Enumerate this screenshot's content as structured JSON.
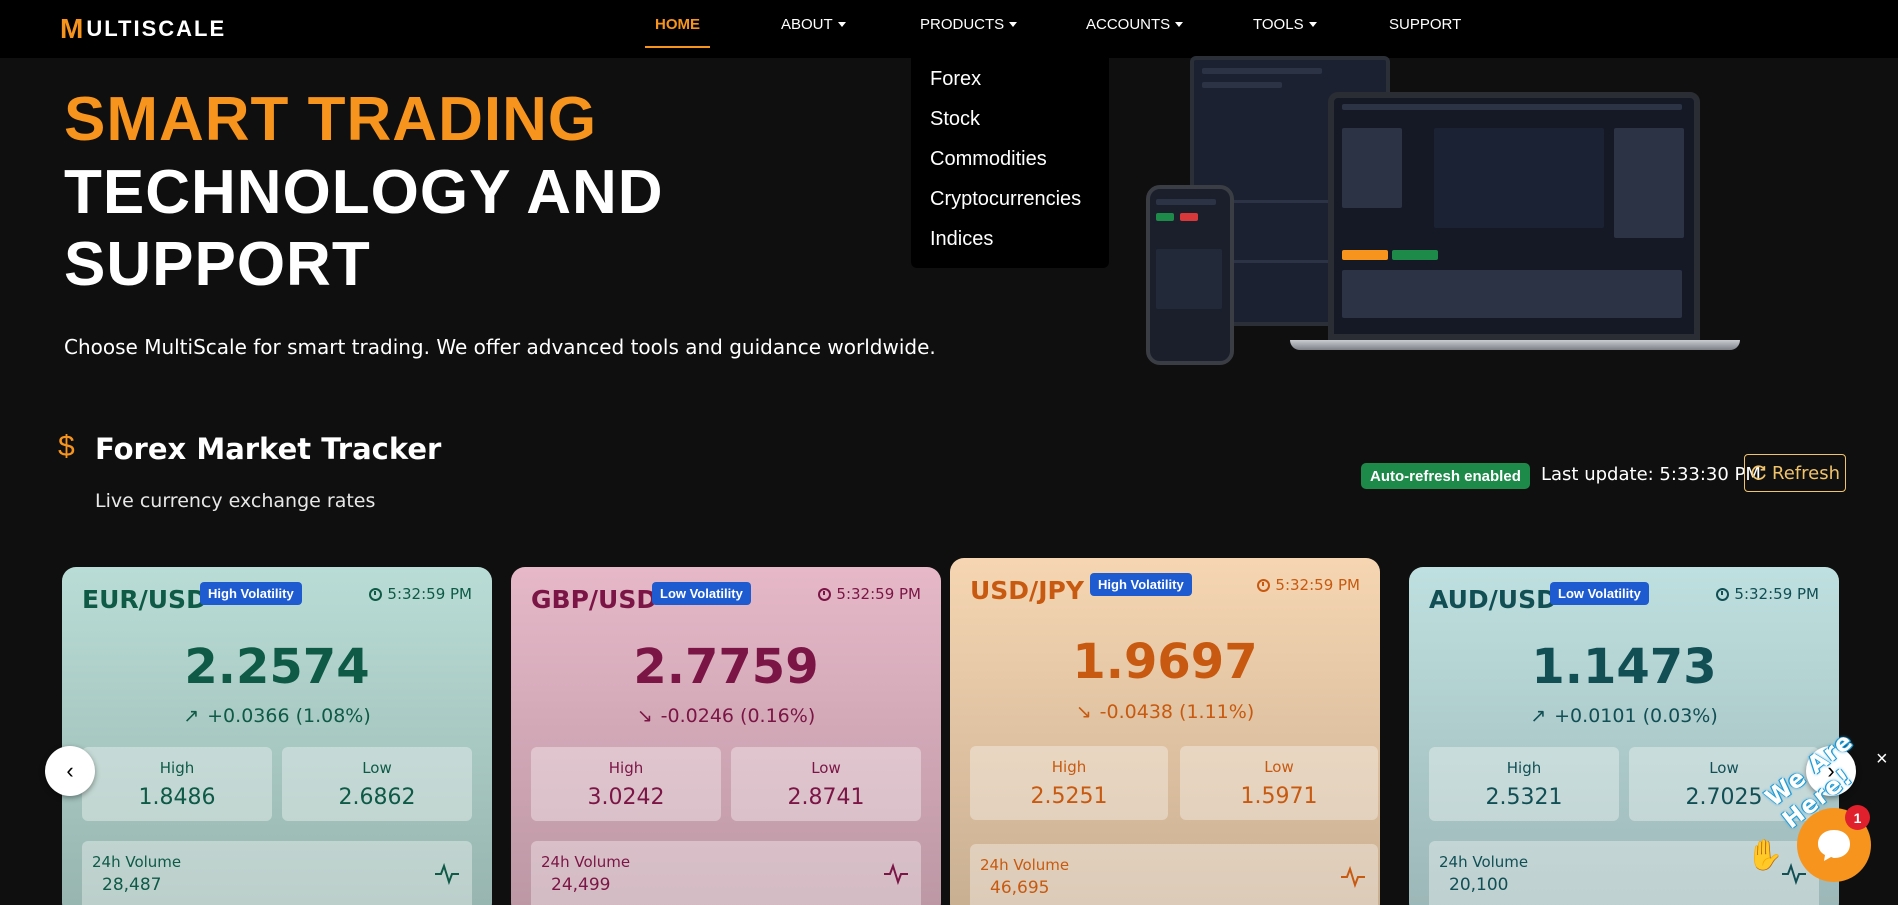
{
  "brand": {
    "logo_mark": "M",
    "logo_text": "ULTISCALE",
    "accent_color": "#f7941d"
  },
  "nav": {
    "home": "HOME",
    "about": "ABOUT",
    "products": "PRODUCTS",
    "accounts": "ACCOUNTS",
    "tools": "TOOLS",
    "support": "SUPPORT"
  },
  "products_menu": [
    "Forex",
    "Stock",
    "Commodities",
    "Cryptocurrencies",
    "Indices"
  ],
  "hero": {
    "line1": "SMART TRADING",
    "line2": "TECHNOLOGY AND",
    "line3": "SUPPORT",
    "subtitle": "Choose MultiScale for smart trading. We offer advanced tools and guidance worldwide."
  },
  "tracker": {
    "icon": "dollar-icon",
    "title": "Forex Market Tracker",
    "subtitle": "Live currency exchange rates",
    "auto_refresh": "Auto-refresh enabled",
    "last_update": "Last update: 5:33:30 PM",
    "refresh_label": "Refresh"
  },
  "cards": [
    {
      "pair": "EUR/USD",
      "volatility": "High Volatility",
      "time": "5:32:59 PM",
      "price": "2.2574",
      "change": "+0.0366 (1.08%)",
      "direction": "up",
      "high_label": "High",
      "high": "1.8486",
      "low_label": "Low",
      "low": "2.6862",
      "volume_label": "24h Volume",
      "volume": "28,487",
      "bg": "#b9ddd6",
      "text_color": "#0e5a47"
    },
    {
      "pair": "GBP/USD",
      "volatility": "Low Volatility",
      "time": "5:32:59 PM",
      "price": "2.7759",
      "change": "-0.0246 (0.16%)",
      "direction": "down",
      "high_label": "High",
      "high": "3.0242",
      "low_label": "Low",
      "low": "2.8741",
      "volume_label": "24h Volume",
      "volume": "24,499",
      "bg": "#e6b8c8",
      "text_color": "#7b1545"
    },
    {
      "pair": "USD/JPY",
      "volatility": "High Volatility",
      "time": "5:32:59 PM",
      "price": "1.9697",
      "change": "-0.0438 (1.11%)",
      "direction": "down",
      "high_label": "High",
      "high": "2.5251",
      "low_label": "Low",
      "low": "1.5971",
      "volume_label": "24h Volume",
      "volume": "46,695",
      "bg": "#f6d6b2",
      "text_color": "#c75a10"
    },
    {
      "pair": "AUD/USD",
      "volatility": "Low Volatility",
      "time": "5:32:59 PM",
      "price": "1.1473",
      "change": "+0.0101 (0.03%)",
      "direction": "up",
      "high_label": "High",
      "high": "2.5321",
      "low_label": "Low",
      "low": "2.7025",
      "volume_label": "24h Volume",
      "volume": "20,100",
      "bg": "#bfe0e0",
      "text_color": "#114f55"
    }
  ],
  "chat": {
    "tagline": "We Are Here!",
    "unread_count": "1",
    "close": "×"
  }
}
